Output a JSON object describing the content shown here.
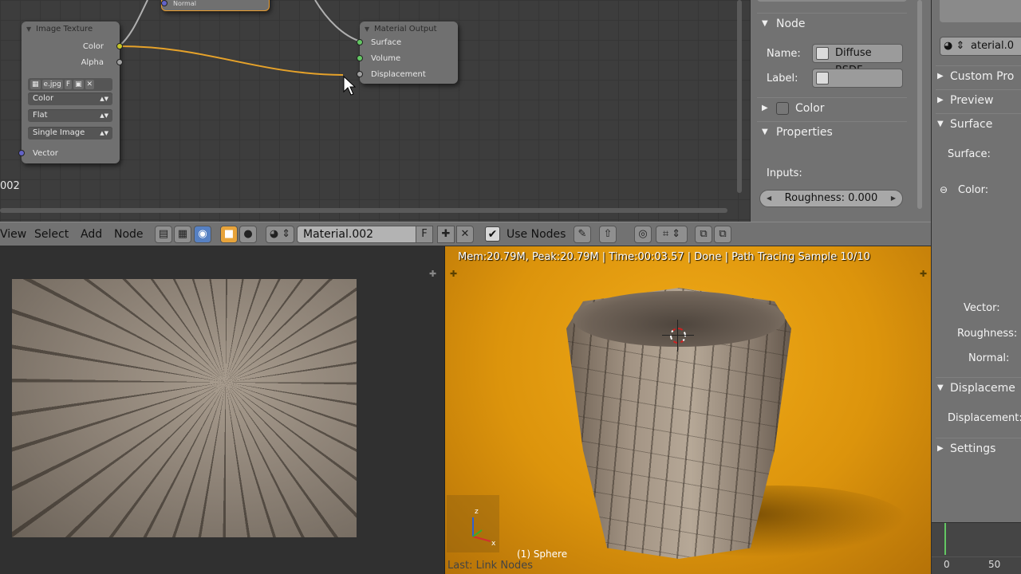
{
  "node_editor": {
    "normal_node_label": "Normal",
    "image_texture": {
      "title": "Image Texture",
      "outputs": [
        "Color",
        "Alpha"
      ],
      "image_name": "e.jpg",
      "image_fake_user": "F",
      "color_space": "Color",
      "projection": "Flat",
      "source": "Single Image",
      "input_vector": "Vector"
    },
    "material_output": {
      "title": "Material Output",
      "inputs": [
        "Surface",
        "Volume",
        "Displacement"
      ]
    },
    "partial_label": "002"
  },
  "node_panel": {
    "node_section": "Node",
    "name_label": "Name:",
    "name_value": "Diffuse BSDF",
    "label_label": "Label:",
    "label_value": "",
    "color_section": "Color",
    "properties_section": "Properties",
    "inputs_label": "Inputs:",
    "roughness": "Roughness: 0.000"
  },
  "header": {
    "menus": [
      "View",
      "Select",
      "Add",
      "Node"
    ],
    "material_name": "Material.002",
    "fake_user": "F",
    "use_nodes_label": "Use Nodes",
    "use_nodes_checked": true
  },
  "viewport": {
    "status": "Mem:20.79M, Peak:20.79M | Time:00:03.57 | Done | Path Tracing Sample 10/10",
    "object_label": "(1) Sphere",
    "last_operation": "Last: Link Nodes",
    "axis_labels": [
      "z",
      "x"
    ],
    "background_color": "#e6a00f"
  },
  "properties": {
    "material_field": "aterial.0",
    "sections": [
      "Custom Pro",
      "Preview",
      "Surface"
    ],
    "surface_label": "Surface:",
    "color_label": "Color:",
    "vector_label": "Vector:",
    "roughness_label": "Roughness:",
    "normal_label": "Normal:",
    "displacement_section": "Displaceme",
    "displacement_label": "Displacement:",
    "settings_section": "Settings"
  },
  "timeline": {
    "ticks": [
      "0",
      "50"
    ]
  }
}
